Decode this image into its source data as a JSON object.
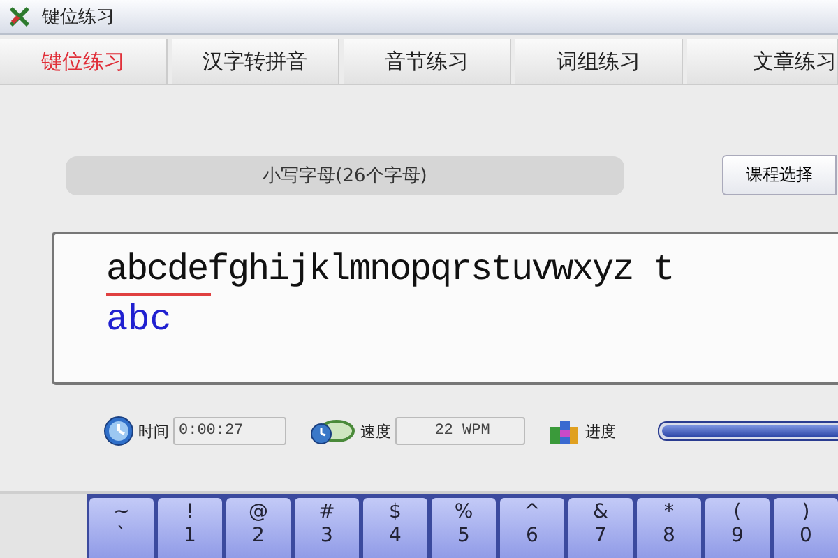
{
  "window": {
    "title": "键位练习"
  },
  "tabs": [
    {
      "label": "键位练习",
      "selected": true
    },
    {
      "label": "汉字转拼音",
      "selected": false
    },
    {
      "label": "音节练习",
      "selected": false
    },
    {
      "label": "词组练习",
      "selected": false
    },
    {
      "label": "文章练习",
      "selected": false
    }
  ],
  "lesson": {
    "title": "小写字母(26个字母)",
    "button": "课程选择"
  },
  "practice": {
    "target": "abcdefghijklmnopqrstuvwxyz t",
    "typed": "abc"
  },
  "stats": [
    {
      "kind": "time",
      "label": "时间",
      "value": "0:00:27"
    },
    {
      "kind": "speed",
      "label": "速度",
      "value": "22 WPM"
    },
    {
      "kind": "progress",
      "label": "进度",
      "level": 1
    }
  ],
  "keys": [
    {
      "shift": "~",
      "base": "`"
    },
    {
      "shift": "!",
      "base": "1"
    },
    {
      "shift": "@",
      "base": "2"
    },
    {
      "shift": "#",
      "base": "3"
    },
    {
      "shift": "$",
      "base": "4"
    },
    {
      "shift": "%",
      "base": "5"
    },
    {
      "shift": "^",
      "base": "6"
    },
    {
      "shift": "&",
      "base": "7"
    },
    {
      "shift": "*",
      "base": "8"
    },
    {
      "shift": "(",
      "base": "9"
    },
    {
      "shift": ")",
      "base": "0"
    }
  ]
}
